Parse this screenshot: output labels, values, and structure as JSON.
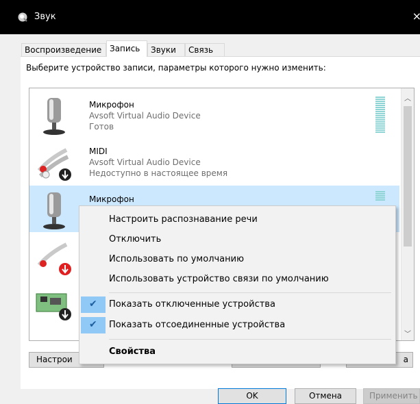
{
  "window": {
    "title": "Звук",
    "close_glyph": "×"
  },
  "tabs": [
    {
      "label": "Воспроизведение",
      "active": false
    },
    {
      "label": "Запись",
      "active": true
    },
    {
      "label": "Звуки",
      "active": false
    },
    {
      "label": "Связь",
      "active": false
    }
  ],
  "instruction": "Выберите устройство записи, параметры которого нужно изменить:",
  "devices": [
    {
      "name": "Микрофон",
      "driver": "Avsoft Virtual Audio Device",
      "status": "Готов",
      "icon": "microphone-icon"
    },
    {
      "name": "MIDI",
      "driver": "Avsoft Virtual Audio Device",
      "status": "Недоступно в настоящее время",
      "icon": "audio-cable-icon"
    },
    {
      "name": "Микрофон",
      "driver": "",
      "status": "",
      "icon": "microphone-icon",
      "selected": true
    }
  ],
  "list_buttons": {
    "configure": "Настрои",
    "properties_partial": "а"
  },
  "context_menu": {
    "items": [
      {
        "label": "Настроить распознавание речи",
        "checked": false
      },
      {
        "label": "Отключить",
        "checked": false
      },
      {
        "label": "Использовать по умолчанию",
        "checked": false
      },
      {
        "label": "Использовать устройство связи по умолчанию",
        "checked": false
      },
      {
        "label": "Показать отключенные устройства",
        "checked": true
      },
      {
        "label": "Показать отсоединенные устройства",
        "checked": true
      },
      {
        "label": "Свойства",
        "checked": false,
        "bold": true
      }
    ],
    "check_glyph": "✔"
  },
  "dialog_buttons": {
    "ok": "OK",
    "cancel": "Отмена",
    "apply": "Применить"
  },
  "colors": {
    "selection": "#cce8ff",
    "menu_check_bg": "#90c8f6",
    "default_button_border": "#0078d7"
  }
}
